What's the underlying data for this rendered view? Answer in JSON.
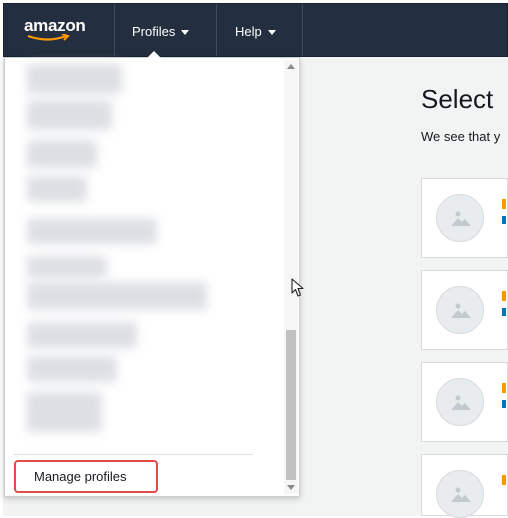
{
  "header": {
    "logo_text": "amazon",
    "nav": [
      {
        "label": "Profiles"
      },
      {
        "label": "Help"
      }
    ]
  },
  "main": {
    "title": "Select",
    "subtitle": "We see that y"
  },
  "dropdown": {
    "manage_label": "Manage profiles"
  },
  "colors": {
    "nav_bg": "#232f3e",
    "highlight": "#e04b4b",
    "accent_orange": "#ff9900",
    "link_blue": "#0073bb"
  },
  "icons": [
    "amazon-smile-icon",
    "caret-down-icon",
    "image-placeholder-icon",
    "mouse-pointer-icon"
  ]
}
